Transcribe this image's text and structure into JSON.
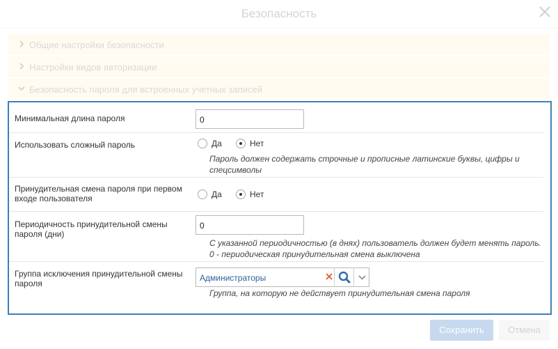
{
  "dialog": {
    "title": "Безопасность",
    "close_icon": "close-icon"
  },
  "sections": [
    {
      "label": "Общие настройки безопасности",
      "expanded": false
    },
    {
      "label": "Настройки видов авторизации",
      "expanded": false
    },
    {
      "label": "Безопасность пароля для встроенных учетных записей",
      "expanded": true
    }
  ],
  "form": {
    "min_length": {
      "label": "Минимальная длина пароля",
      "value": "0"
    },
    "complex_password": {
      "label": "Использовать сложный пароль",
      "yes": "Да",
      "no": "Нет",
      "selected": "no",
      "hint_line1": "Пароль должен содержать строчные и прописные латинские буквы, цифры и",
      "hint_line2": "спецсимволы"
    },
    "force_change": {
      "label_line1": "Принудительная смена пароля при первом",
      "label_line2": "входе пользователя",
      "yes": "Да",
      "no": "Нет",
      "selected": "no"
    },
    "period": {
      "label_line1": "Периодичность принудительной смены",
      "label_line2": "пароля (дни)",
      "value": "0",
      "hint_line1": "С указанной периодичностью (в днях) пользователь должен будет менять пароль.",
      "hint_line2": "0 - периодическая принудительная смена выключена"
    },
    "exclusion_group": {
      "label_line1": "Группа исключения принудительной смены",
      "label_line2": "пароля",
      "value": "Администраторы",
      "hint": "Группа, на которую не действует принудительная смена пароля"
    }
  },
  "buttons": {
    "save": "Сохранить",
    "cancel": "Отмена"
  },
  "colors": {
    "panel_border": "#3d7ebc",
    "link_text": "#2d5f9e",
    "clear_icon": "#e05a2b",
    "search_icon": "#2f6db0"
  }
}
